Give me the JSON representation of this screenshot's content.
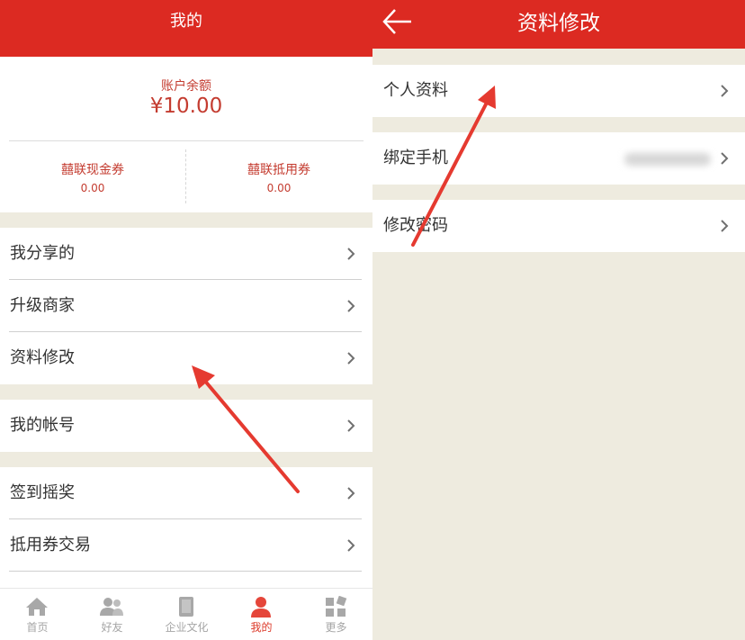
{
  "left": {
    "title": "我的",
    "balance": {
      "label": "账户余额",
      "amount": "¥10.00"
    },
    "coupons": [
      {
        "name": "囍联现金券",
        "value": "0.00"
      },
      {
        "name": "囍联抵用券",
        "value": "0.00"
      }
    ],
    "menu": {
      "share": "我分享的",
      "upgrade": "升级商家",
      "edit_profile": "资料修改",
      "account": "我的帐号",
      "checkin": "签到摇奖",
      "coupon_trade": "抵用券交易"
    },
    "tabs": {
      "home": "首页",
      "friends": "好友",
      "culture": "企业文化",
      "mine": "我的",
      "more": "更多"
    }
  },
  "right": {
    "title": "资料修改",
    "items": {
      "personal": "个人资料",
      "bind_phone": "绑定手机",
      "change_password": "修改密码"
    }
  },
  "colors": {
    "accent": "#dc2a22",
    "background": "#eeebdf",
    "text_red": "#c43c30"
  },
  "icons": [
    "back-arrow-icon",
    "chevron-right-icon",
    "home-icon",
    "friends-icon",
    "book-icon",
    "person-icon",
    "grid-icon"
  ]
}
